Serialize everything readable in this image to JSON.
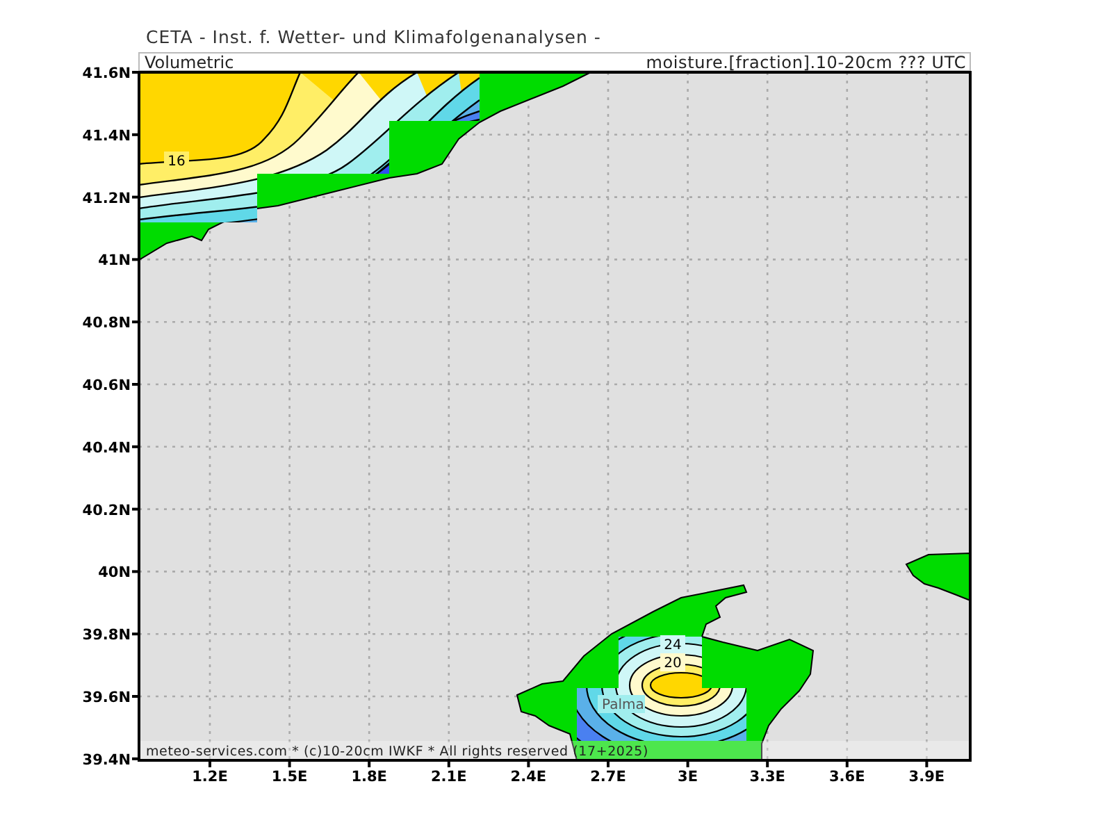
{
  "header": {
    "title": "CETA - Inst. f. Wetter- und Klimafolgenanalysen -",
    "subtitle_left": "Volumetric",
    "subtitle_right": "moisture.[fraction].10-20cm ??? UTC"
  },
  "map": {
    "y_ticks": [
      "41.6N",
      "41.4N",
      "41.2N",
      "41N",
      "40.8N",
      "40.6N",
      "40.4N",
      "40.2N",
      "40N",
      "39.8N",
      "39.6N",
      "39.4N"
    ],
    "x_ticks": [
      "1.2E",
      "1.5E",
      "1.8E",
      "2.1E",
      "2.4E",
      "2.7E",
      "3E",
      "3.3E",
      "3.6E",
      "3.9E"
    ],
    "contour_labels": [
      {
        "text": "16"
      },
      {
        "text": "24"
      },
      {
        "text": "20"
      }
    ],
    "place_labels": [
      "Palma"
    ],
    "footer": "meteo-services.com * (c)10-20cm IWKF * All rights reserved (17+2025)"
  }
}
